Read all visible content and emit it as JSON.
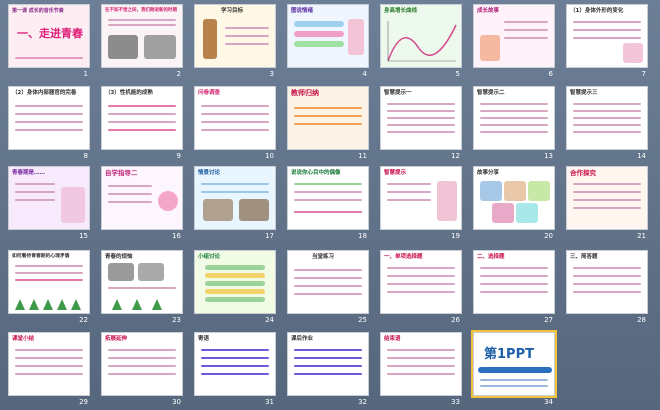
{
  "slides": [
    {
      "n": "1",
      "title": "一、走进青春",
      "sub": "第一课  成长的音乐节奏"
    },
    {
      "n": "2",
      "title": "在不知不觉之间，我们跨进新的时期"
    },
    {
      "n": "3",
      "title": "学习目标"
    },
    {
      "n": "4",
      "title": "图说情绪"
    },
    {
      "n": "5",
      "title": "身高增长曲线"
    },
    {
      "n": "6",
      "title": "成长故事"
    },
    {
      "n": "7",
      "title": "（1）身体外形的变化"
    },
    {
      "n": "8",
      "title": "（2）身体内部器官的完善"
    },
    {
      "n": "9",
      "title": "（3）性机能的成熟"
    },
    {
      "n": "10",
      "title": "问卷调查"
    },
    {
      "n": "11",
      "title": "教师归纳"
    },
    {
      "n": "12",
      "title": "智慧提示一"
    },
    {
      "n": "13",
      "title": "智慧提示二"
    },
    {
      "n": "14",
      "title": "智慧提示三"
    },
    {
      "n": "15",
      "title": "青春期是……"
    },
    {
      "n": "16",
      "title": "自学指导二"
    },
    {
      "n": "17",
      "title": "情景讨论"
    },
    {
      "n": "18",
      "title": "说说你心目中的偶像"
    },
    {
      "n": "19",
      "title": "智慧提示"
    },
    {
      "n": "20",
      "title": "故事分享"
    },
    {
      "n": "21",
      "title": "合作探究"
    },
    {
      "n": "22",
      "title": "如何看待青春期的心理矛盾"
    },
    {
      "n": "23",
      "title": "青春的烦恼"
    },
    {
      "n": "24",
      "title": "小组讨论"
    },
    {
      "n": "25",
      "title": "当堂练习"
    },
    {
      "n": "26",
      "title": "一、单项选择题"
    },
    {
      "n": "27",
      "title": "二、选择题"
    },
    {
      "n": "28",
      "title": "三、简答题"
    },
    {
      "n": "29",
      "title": "课堂小结"
    },
    {
      "n": "30",
      "title": "拓展延伸"
    },
    {
      "n": "31",
      "title": "寄语"
    },
    {
      "n": "32",
      "title": "课后作业"
    },
    {
      "n": "33",
      "title": "结束语"
    },
    {
      "n": "34",
      "title": "第1PPT"
    }
  ],
  "colors": {
    "background": "#5d6f86",
    "selection": "#f3c23b",
    "accent": "#d6246f"
  }
}
